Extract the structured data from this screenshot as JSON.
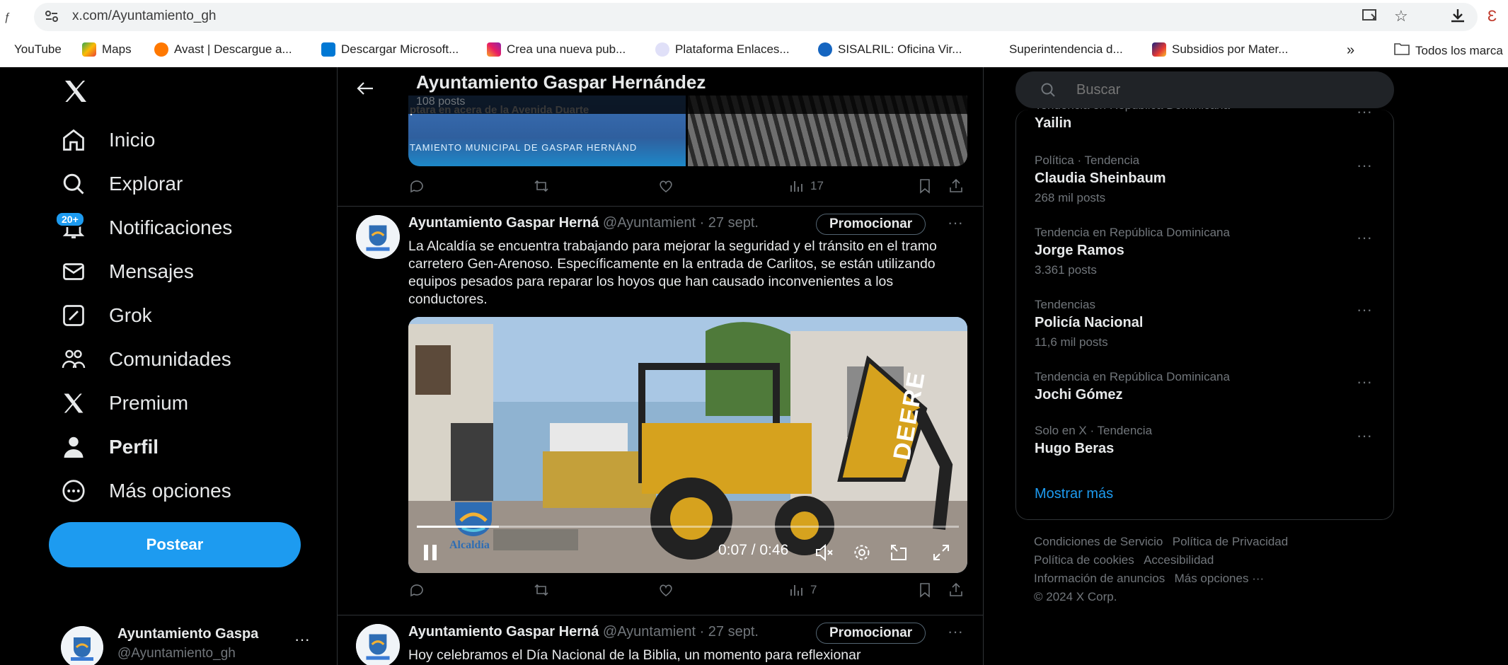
{
  "browser": {
    "url": "x.com/Ayuntamiento_gh",
    "bookmarks": [
      {
        "label": "YouTube"
      },
      {
        "label": "Maps"
      },
      {
        "label": "Avast | Descargue a..."
      },
      {
        "label": "Descargar Microsoft..."
      },
      {
        "label": "Crea una nueva pub..."
      },
      {
        "label": "Plataforma Enlaces..."
      },
      {
        "label": "SISALRIL: Oficina Vir..."
      },
      {
        "label": "Superintendencia d..."
      },
      {
        "label": "Subsidios por Mater..."
      }
    ],
    "more_bookmarks": "»",
    "all_bookmarks": "Todos los marca"
  },
  "sidebar": {
    "items": [
      {
        "label": "Inicio"
      },
      {
        "label": "Explorar"
      },
      {
        "label": "Notificaciones",
        "badge": "20+"
      },
      {
        "label": "Mensajes"
      },
      {
        "label": "Grok"
      },
      {
        "label": "Comunidades"
      },
      {
        "label": "Premium"
      },
      {
        "label": "Perfil"
      },
      {
        "label": "Más opciones"
      }
    ],
    "post_button": "Postear",
    "account": {
      "name": "Ayuntamiento Gaspa",
      "handle": "@Ayuntamiento_gh",
      "more": "···"
    }
  },
  "header": {
    "title": "Ayuntamiento Gaspar Hernández",
    "posts": "108 posts"
  },
  "prev_tweet": {
    "image_text_1": "ptara en acera de la Avenida Duarte",
    "image_text_2": "TAMIENTO MUNICIPAL DE  GASPAR HERNÁND",
    "views": "17"
  },
  "tweet1": {
    "name": "Ayuntamiento Gaspar Herná",
    "handle": "@Ayuntamient",
    "date": "· 27 sept.",
    "promote": "Promocionar",
    "more": "···",
    "text": "La Alcaldía se encuentra trabajando para mejorar la seguridad y el tránsito en el tramo carretero Gen-Arenoso. Específicamente en la entrada de Carlitos, se están utilizando equipos pesados para reparar los hoyos que han causado inconvenientes a los conductores.",
    "video_time": "0:07 / 0:46",
    "video_progress": 0.152,
    "logo_text": "Alcaldía",
    "machine_text": "DEERE",
    "views": "7"
  },
  "tweet2": {
    "name": "Ayuntamiento Gaspar Herná",
    "handle": "@Ayuntamient",
    "date": "· 27 sept.",
    "promote": "Promocionar",
    "more": "···",
    "text": "Hoy celebramos el Día Nacional de la Biblia, un momento para reflexionar"
  },
  "search": {
    "placeholder": "Buscar"
  },
  "trends": [
    {
      "context": "Tendencia en República Dominicana",
      "title": "Yailin",
      "count": ""
    },
    {
      "context": "Política · Tendencia",
      "title": "Claudia Sheinbaum",
      "count": "268 mil posts"
    },
    {
      "context": "Tendencia en República Dominicana",
      "title": "Jorge Ramos",
      "count": "3.361 posts"
    },
    {
      "context": "Tendencias",
      "title": "Policía Nacional",
      "count": "11,6 mil posts"
    },
    {
      "context": "Tendencia en República Dominicana",
      "title": "Jochi Gómez",
      "count": ""
    },
    {
      "context": "Solo en X · Tendencia",
      "title": "Hugo Beras",
      "count": ""
    }
  ],
  "show_more": "Mostrar más",
  "footer": {
    "links": [
      "Condiciones de Servicio",
      "Política de Privacidad",
      "Política de cookies",
      "Accesibilidad",
      "Información de anuncios",
      "Más opciones ···"
    ],
    "copyright": "© 2024 X Corp."
  },
  "colors": {
    "accent": "#1d9bf0",
    "background": "#000000",
    "muted": "#71767b"
  }
}
